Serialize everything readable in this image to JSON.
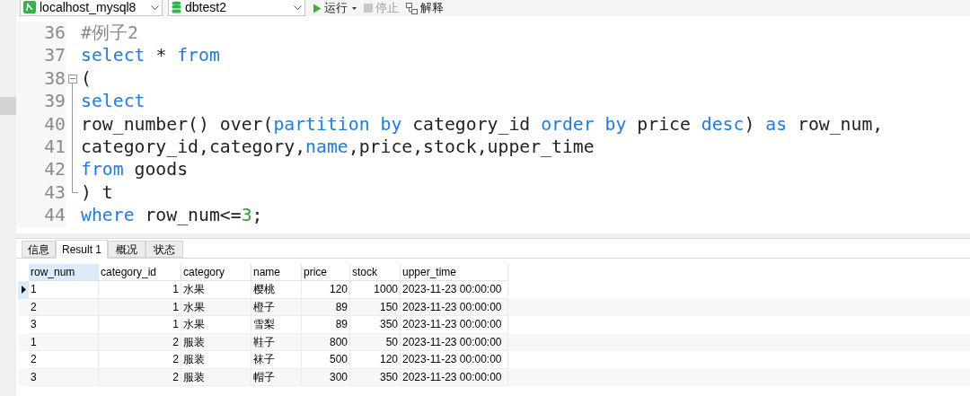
{
  "toolbar": {
    "connection": "localhost_mysql8",
    "database": "dbtest2",
    "buttons": [
      {
        "label": "运行",
        "kind": "run",
        "disabled": false
      },
      {
        "label": "停止",
        "kind": "stop",
        "disabled": true
      },
      {
        "label": "解释",
        "kind": "explain",
        "disabled": false
      }
    ]
  },
  "editor": {
    "lines": [
      {
        "number": "36",
        "kind": "plain",
        "tokens": [
          {
            "kind": "comment",
            "text": "#例子2"
          }
        ]
      },
      {
        "number": "37",
        "kind": "plain",
        "tokens": [
          {
            "kind": "keyword",
            "text": "select"
          },
          {
            "kind": "plain",
            "text": " * "
          },
          {
            "kind": "keyword",
            "text": "from"
          }
        ]
      },
      {
        "number": "38",
        "kind": "fold_start",
        "tokens": [
          {
            "kind": "plain",
            "text": "("
          }
        ]
      },
      {
        "number": "39",
        "kind": "fold_inside",
        "tokens": [
          {
            "kind": "keyword",
            "text": "select"
          }
        ]
      },
      {
        "number": "40",
        "kind": "fold_inside",
        "tokens": [
          {
            "kind": "plain",
            "text": "row_number() over("
          },
          {
            "kind": "keyword",
            "text": "partition by"
          },
          {
            "kind": "plain",
            "text": " category_id "
          },
          {
            "kind": "keyword",
            "text": "order by"
          },
          {
            "kind": "plain",
            "text": " price "
          },
          {
            "kind": "keyword",
            "text": "desc"
          },
          {
            "kind": "plain",
            "text": ") "
          },
          {
            "kind": "keyword",
            "text": "as"
          },
          {
            "kind": "plain",
            "text": " row_num,"
          }
        ]
      },
      {
        "number": "41",
        "kind": "fold_inside",
        "tokens": [
          {
            "kind": "plain",
            "text": "category_id,category,"
          },
          {
            "kind": "keyword",
            "text": "name"
          },
          {
            "kind": "plain",
            "text": ",price,stock,upper_time"
          }
        ]
      },
      {
        "number": "42",
        "kind": "fold_inside",
        "tokens": [
          {
            "kind": "keyword",
            "text": "from"
          },
          {
            "kind": "plain",
            "text": " goods"
          }
        ]
      },
      {
        "number": "43",
        "kind": "fold_end",
        "tokens": [
          {
            "kind": "plain",
            "text": ") t"
          }
        ]
      },
      {
        "number": "44",
        "kind": "plain",
        "tokens": [
          {
            "kind": "keyword",
            "text": "where"
          },
          {
            "kind": "plain",
            "text": " row_num<="
          },
          {
            "kind": "number",
            "text": "3"
          },
          {
            "kind": "plain",
            "text": ";"
          }
        ]
      }
    ]
  },
  "result_tabs": [
    {
      "label": "信息",
      "selected": false
    },
    {
      "label": "Result 1",
      "selected": true
    },
    {
      "label": "概况",
      "selected": false
    },
    {
      "label": "状态",
      "selected": false
    }
  ],
  "table": {
    "columns": [
      {
        "label": "row_num",
        "kind": "text",
        "selected": true
      },
      {
        "label": "category_id",
        "kind": "number",
        "selected": false
      },
      {
        "label": "category",
        "kind": "text",
        "selected": false
      },
      {
        "label": "name",
        "kind": "text",
        "selected": false
      },
      {
        "label": "price",
        "kind": "number",
        "selected": false
      },
      {
        "label": "stock",
        "kind": "number",
        "selected": false
      },
      {
        "label": "upper_time",
        "kind": "text",
        "selected": false
      }
    ],
    "rows": [
      {
        "current": true,
        "cells": [
          "1",
          "1",
          "水果",
          "樱桃",
          "120",
          "1000",
          "2023-11-23 00:00:00"
        ]
      },
      {
        "current": false,
        "cells": [
          "2",
          "1",
          "水果",
          "橙子",
          "89",
          "150",
          "2023-11-23 00:00:00"
        ]
      },
      {
        "current": false,
        "cells": [
          "3",
          "1",
          "水果",
          "雪梨",
          "89",
          "350",
          "2023-11-23 00:00:00"
        ]
      },
      {
        "current": false,
        "cells": [
          "1",
          "2",
          "服装",
          "鞋子",
          "800",
          "50",
          "2023-11-23 00:00:00"
        ]
      },
      {
        "current": false,
        "cells": [
          "2",
          "2",
          "服装",
          "袜子",
          "500",
          "120",
          "2023-11-23 00:00:00"
        ]
      },
      {
        "current": false,
        "cells": [
          "3",
          "2",
          "服装",
          "帽子",
          "300",
          "350",
          "2023-11-23 00:00:00"
        ]
      }
    ]
  }
}
